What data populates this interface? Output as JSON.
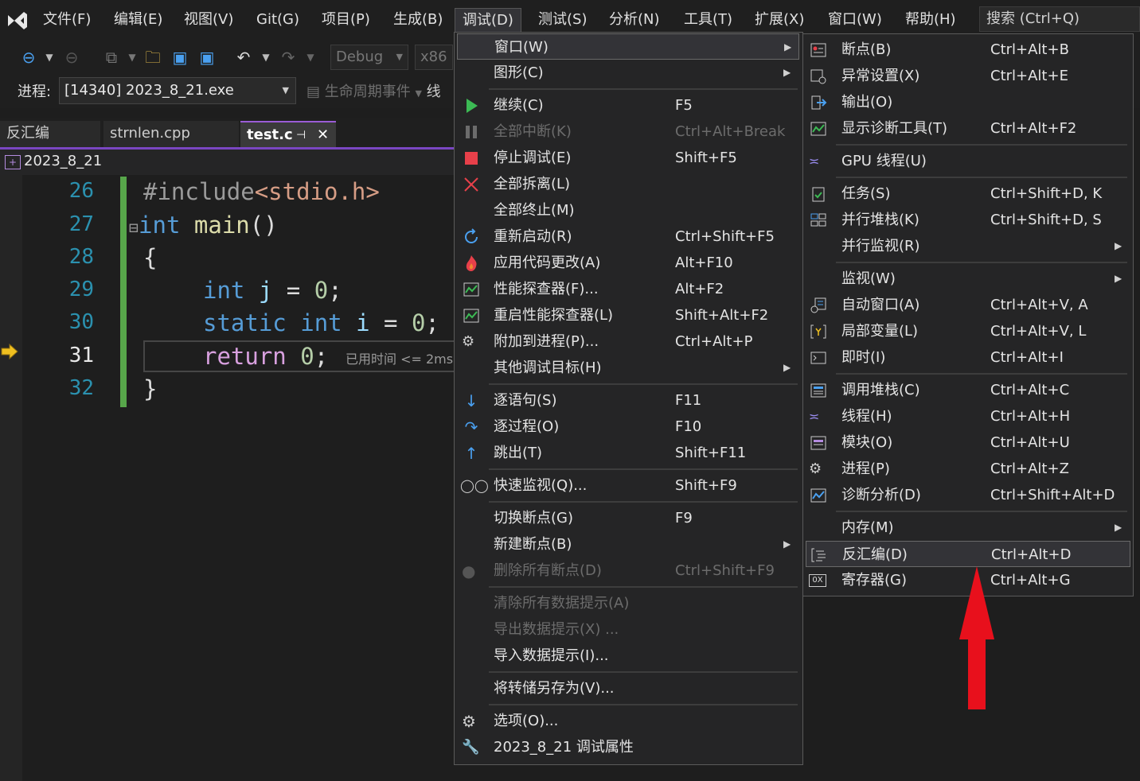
{
  "menubar": {
    "items": [
      "文件(F)",
      "编辑(E)",
      "视图(V)",
      "Git(G)",
      "项目(P)",
      "生成(B)",
      "调试(D)",
      "测试(S)",
      "分析(N)",
      "工具(T)",
      "扩展(X)",
      "窗口(W)",
      "帮助(H)"
    ],
    "search": "搜索 (Ctrl+Q)"
  },
  "toolbar": {
    "config": "Debug",
    "platform": "x86"
  },
  "process_bar": {
    "label": "进程:",
    "process": "[14340] 2023_8_21.exe",
    "lifecycle": "生命周期事件",
    "thread": "线"
  },
  "tabs": [
    "反汇编",
    "strnlen.cpp",
    "test.c"
  ],
  "navbar": {
    "project": "2023_8_21"
  },
  "editor": {
    "line_numbers": [
      "26",
      "27",
      "28",
      "29",
      "30",
      "31",
      "32"
    ],
    "elapsed": "已用时间 <= 2ms"
  },
  "debug_menu": {
    "items": [
      {
        "label": "窗口(W)",
        "shortcut": ""
      },
      {
        "label": "图形(C)",
        "shortcut": ""
      },
      {
        "label": "继续(C)",
        "shortcut": "F5"
      },
      {
        "label": "全部中断(K)",
        "shortcut": "Ctrl+Alt+Break"
      },
      {
        "label": "停止调试(E)",
        "shortcut": "Shift+F5"
      },
      {
        "label": "全部拆离(L)",
        "shortcut": ""
      },
      {
        "label": "全部终止(M)",
        "shortcut": ""
      },
      {
        "label": "重新启动(R)",
        "shortcut": "Ctrl+Shift+F5"
      },
      {
        "label": "应用代码更改(A)",
        "shortcut": "Alt+F10"
      },
      {
        "label": "性能探查器(F)...",
        "shortcut": "Alt+F2"
      },
      {
        "label": "重启性能探查器(L)",
        "shortcut": "Shift+Alt+F2"
      },
      {
        "label": "附加到进程(P)...",
        "shortcut": "Ctrl+Alt+P"
      },
      {
        "label": "其他调试目标(H)",
        "shortcut": ""
      },
      {
        "label": "逐语句(S)",
        "shortcut": "F11"
      },
      {
        "label": "逐过程(O)",
        "shortcut": "F10"
      },
      {
        "label": "跳出(T)",
        "shortcut": "Shift+F11"
      },
      {
        "label": "快速监视(Q)...",
        "shortcut": "Shift+F9"
      },
      {
        "label": "切换断点(G)",
        "shortcut": "F9"
      },
      {
        "label": "新建断点(B)",
        "shortcut": ""
      },
      {
        "label": "删除所有断点(D)",
        "shortcut": "Ctrl+Shift+F9"
      },
      {
        "label": "清除所有数据提示(A)",
        "shortcut": ""
      },
      {
        "label": "导出数据提示(X) ...",
        "shortcut": ""
      },
      {
        "label": "导入数据提示(I)...",
        "shortcut": ""
      },
      {
        "label": "将转储另存为(V)...",
        "shortcut": ""
      },
      {
        "label": "选项(O)...",
        "shortcut": ""
      },
      {
        "label": "2023_8_21 调试属性",
        "shortcut": ""
      }
    ]
  },
  "window_submenu": {
    "items": [
      {
        "label": "断点(B)",
        "shortcut": "Ctrl+Alt+B"
      },
      {
        "label": "异常设置(X)",
        "shortcut": "Ctrl+Alt+E"
      },
      {
        "label": "输出(O)",
        "shortcut": ""
      },
      {
        "label": "显示诊断工具(T)",
        "shortcut": "Ctrl+Alt+F2"
      },
      {
        "label": "GPU 线程(U)",
        "shortcut": ""
      },
      {
        "label": "任务(S)",
        "shortcut": "Ctrl+Shift+D, K"
      },
      {
        "label": "并行堆栈(K)",
        "shortcut": "Ctrl+Shift+D, S"
      },
      {
        "label": "并行监视(R)",
        "shortcut": ""
      },
      {
        "label": "监视(W)",
        "shortcut": ""
      },
      {
        "label": "自动窗口(A)",
        "shortcut": "Ctrl+Alt+V, A"
      },
      {
        "label": "局部变量(L)",
        "shortcut": "Ctrl+Alt+V, L"
      },
      {
        "label": "即时(I)",
        "shortcut": "Ctrl+Alt+I"
      },
      {
        "label": "调用堆栈(C)",
        "shortcut": "Ctrl+Alt+C"
      },
      {
        "label": "线程(H)",
        "shortcut": "Ctrl+Alt+H"
      },
      {
        "label": "模块(O)",
        "shortcut": "Ctrl+Alt+U"
      },
      {
        "label": "进程(P)",
        "shortcut": "Ctrl+Alt+Z"
      },
      {
        "label": "诊断分析(D)",
        "shortcut": "Ctrl+Shift+Alt+D"
      },
      {
        "label": "内存(M)",
        "shortcut": ""
      },
      {
        "label": "反汇编(D)",
        "shortcut": "Ctrl+Alt+D"
      },
      {
        "label": "寄存器(G)",
        "shortcut": "Ctrl+Alt+G"
      }
    ]
  },
  "colors": {
    "accent": "#7a46c2",
    "annotation_arrow": "#e8101c",
    "green_bar": "#57a64a"
  }
}
